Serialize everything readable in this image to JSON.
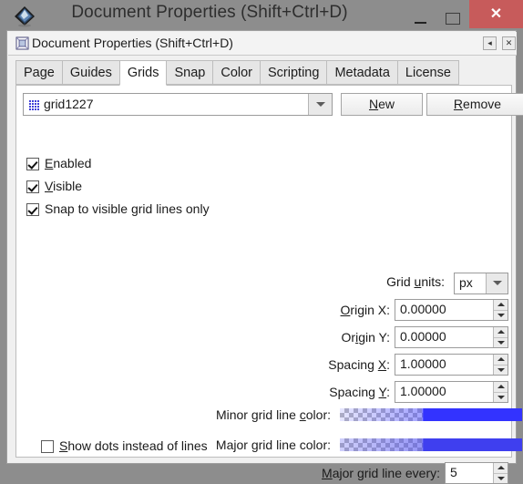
{
  "window": {
    "title": "Document Properties (Shift+Ctrl+D)",
    "app_icon": "inkscape-logo-icon",
    "controls": {
      "minimize": "minimize-icon",
      "maximize": "maximize-icon",
      "close": "✕"
    },
    "close_button_color": "#c75b5b"
  },
  "panel": {
    "icon": "document-properties-icon",
    "title": "Document Properties (Shift+Ctrl+D)",
    "collapse_glyph": "◂",
    "close_glyph": "✕"
  },
  "tabs": [
    {
      "label": "Page",
      "active": false
    },
    {
      "label": "Guides",
      "active": false
    },
    {
      "label": "Grids",
      "active": true
    },
    {
      "label": "Snap",
      "active": false
    },
    {
      "label": "Color",
      "active": false
    },
    {
      "label": "Scripting",
      "active": false
    },
    {
      "label": "Metadata",
      "active": false
    },
    {
      "label": "License",
      "active": false
    }
  ],
  "grids": {
    "selector": {
      "value": "grid1227",
      "icon": "grid-icon"
    },
    "new_button": "New",
    "remove_button": "Remove",
    "checkboxes": [
      {
        "label": "Enabled",
        "checked": true
      },
      {
        "label": "Visible",
        "checked": true
      },
      {
        "label": "Snap to visible grid lines only",
        "checked": true
      }
    ],
    "units": {
      "label": "Grid units:",
      "value": "px"
    },
    "fields": [
      {
        "label": "Origin X:",
        "value": "0.00000"
      },
      {
        "label": "Origin Y:",
        "value": "0.00000"
      },
      {
        "label": "Spacing X:",
        "value": "1.00000"
      },
      {
        "label": "Spacing Y:",
        "value": "1.00000"
      }
    ],
    "colors": [
      {
        "label": "Minor grid line color:",
        "color": "#3333ff",
        "swatch": "minor-grid-color-swatch"
      },
      {
        "label": "Major grid line color:",
        "color": "#3f3fef",
        "swatch": "major-grid-color-swatch"
      }
    ],
    "major_every": {
      "label": "Major grid line every:",
      "value": "5"
    },
    "show_dots": {
      "label": "Show dots instead of lines",
      "checked": false
    }
  }
}
